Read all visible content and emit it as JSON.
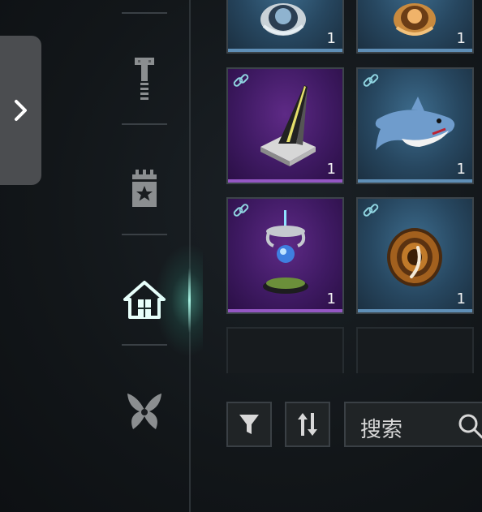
{
  "side_panel": {
    "expand_icon": "chevron-right-icon"
  },
  "nav": {
    "items": [
      {
        "id": "bolt",
        "icon": "bolt-icon",
        "active": false
      },
      {
        "id": "calendar",
        "icon": "calendar-star-icon",
        "active": false
      },
      {
        "id": "home",
        "icon": "home-icon",
        "active": true
      },
      {
        "id": "butterfly",
        "icon": "butterfly-icon",
        "active": false
      }
    ]
  },
  "inventory": {
    "slots": [
      {
        "rarity": "blue",
        "item": "silver-orb-trophy",
        "qty": "1",
        "linked": false
      },
      {
        "rarity": "blue",
        "item": "bronze-orb-trophy",
        "qty": "1",
        "linked": false
      },
      {
        "rarity": "purple",
        "item": "launch-ramp-tower",
        "qty": "1",
        "linked": true
      },
      {
        "rarity": "blue",
        "item": "shark-plush",
        "qty": "1",
        "linked": true
      },
      {
        "rarity": "purple",
        "item": "floating-orb-device",
        "qty": "1",
        "linked": true
      },
      {
        "rarity": "blue",
        "item": "spiral-shell-fossil",
        "qty": "1",
        "linked": true
      },
      {
        "rarity": "empty"
      },
      {
        "rarity": "empty"
      }
    ]
  },
  "toolbar": {
    "filter_icon": "filter-icon",
    "sort_icon": "sort-icon",
    "search_placeholder": "搜索",
    "search_icon": "search-icon"
  },
  "colors": {
    "accent_glow": "#7fffe0",
    "rarity_blue": "#5f8fb7",
    "rarity_purple": "#9457c4"
  }
}
